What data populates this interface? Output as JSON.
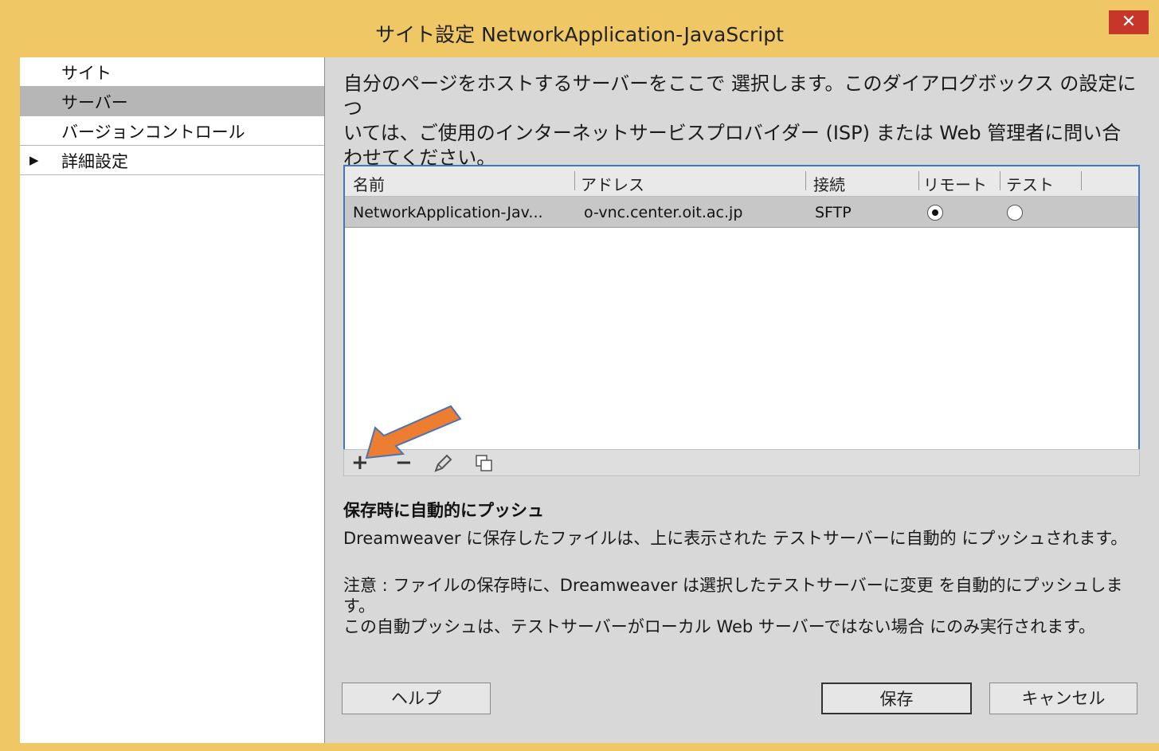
{
  "window": {
    "title": "サイト設定 NetworkApplication-JavaScript",
    "close_glyph": "✕"
  },
  "sidebar": {
    "items": [
      {
        "label": "サイト",
        "selected": false,
        "expandable": false
      },
      {
        "label": "サーバー",
        "selected": true,
        "expandable": false
      },
      {
        "label": "バージョンコントロール",
        "selected": false,
        "expandable": false
      },
      {
        "label": "詳細設定",
        "selected": false,
        "expandable": true
      }
    ],
    "expand_glyph": "▶"
  },
  "main": {
    "description": "自分のページをホストするサーバーをここで 選択します。このダイアログボックスの設定についてはご使用のインターネットサービスプロバイダー (ISP) または Web 管理者に問い合わせてください。",
    "description_lines": [
      "自分のページをホストするサーバーをここで 選択します。このダイアログボックス の設定につ",
      "いては、ご使用のインターネットサービスプロバイダー (ISP) または Web 管理者に問い合",
      "わせてください。"
    ],
    "table": {
      "columns": [
        "名前",
        "アドレス",
        "接続",
        "リモート",
        "テスト"
      ],
      "rows": [
        {
          "name": "NetworkApplication-Jav...",
          "address": "o-vnc.center.oit.ac.jp",
          "connection": "SFTP",
          "remote": true,
          "test": false
        }
      ]
    },
    "toolbar": {
      "add_glyph": "+",
      "remove_glyph": "−",
      "edit_icon": "pencil-icon",
      "duplicate_icon": "duplicate-icon"
    },
    "push_section": {
      "title": "保存時に自動的にプッシュ",
      "description": "Dreamweaver に保存したファイルは、上に表示された テストサーバーに自動的 にプッシュされます。"
    },
    "note_lines": [
      "注意 : ファイルの保存時に、Dreamweaver は選択したテストサーバーに変更 を自動的にプッシュします。",
      "この自動プッシュは、テストサーバーがローカル Web サーバーではない場合 にのみ実行されます。"
    ],
    "buttons": {
      "help": "ヘルプ",
      "save": "保存",
      "cancel": "キャンセル"
    }
  },
  "colors": {
    "frame": "#f0c765",
    "close": "#c7362b",
    "table_border": "#3c78c3",
    "callout_arrow": "#ed7d31"
  }
}
